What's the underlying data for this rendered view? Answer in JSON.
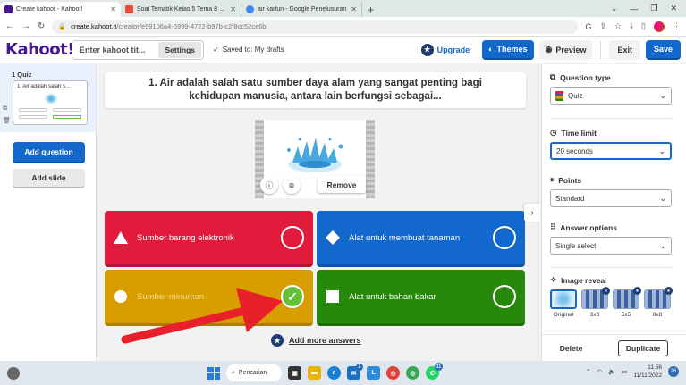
{
  "browser": {
    "tabs": [
      {
        "label": "Create kahoot - Kahoot!",
        "active": true,
        "favicon_color": "#46178f"
      },
      {
        "label": "Soal Tematik Kelas 5 Tema 8 Sub",
        "active": false,
        "favicon_color": "#e64b3c"
      },
      {
        "label": "air karfun - Google Penelusuran",
        "active": false,
        "favicon_color": "#4285f4"
      }
    ],
    "new_tab_label": "+",
    "url_host": "create.kahoot.it",
    "url_path": "/creator/e99106a4-6999-4722-b97b-c2f8cc52ce6b"
  },
  "header": {
    "logo": "Kahoot!",
    "title_placeholder": "Enter kahoot tit...",
    "settings_label": "Settings",
    "saved_text": "Saved to: My drafts",
    "upgrade_label": "Upgrade",
    "themes_label": "Themes",
    "preview_label": "Preview",
    "exit_label": "Exit",
    "save_label": "Save"
  },
  "sidebar": {
    "quiz_header": "1  Quiz",
    "quiz_thumb_title": "1. Air adalah salah s...",
    "add_question_label": "Add question",
    "add_slide_label": "Add slide"
  },
  "editor": {
    "question_text": "1. Air adalah salah satu sumber daya alam yang sangat penting bagi kehidupan manusia, antara lain berfungsi sebagai...",
    "remove_label": "Remove",
    "answers": [
      {
        "text": "Sumber barang elektronik",
        "color": "#e21b3c",
        "shape": "triangle",
        "correct": false
      },
      {
        "text": "Alat untuk membuat tanaman",
        "color": "#1368ce",
        "shape": "diamond",
        "correct": false
      },
      {
        "text": "Sumber minuman",
        "color": "#d89e00",
        "shape": "circle",
        "correct": true
      },
      {
        "text": "Alat untuk bahan bakar",
        "color": "#26890c",
        "shape": "square",
        "correct": false
      }
    ],
    "add_more_label": "Add more answers"
  },
  "panel": {
    "question_type_label": "Question type",
    "question_type_value": "Quiz",
    "time_limit_label": "Time limit",
    "time_limit_value": "20 seconds",
    "points_label": "Points",
    "points_value": "Standard",
    "answer_options_label": "Answer options",
    "answer_options_value": "Single select",
    "image_reveal_label": "Image reveal",
    "reveal_options": [
      "Original",
      "3x3",
      "5x5",
      "8x8"
    ],
    "delete_label": "Delete",
    "duplicate_label": "Duplicate"
  },
  "taskbar": {
    "search_label": "Pencarian",
    "time": "11.56",
    "date": "11/11/2022",
    "notification_count": "26",
    "badge_mail": "2",
    "badge_chat": "11"
  },
  "colors": {
    "kahoot_purple": "#46178f",
    "primary_blue": "#1368ce",
    "arrow_red": "#e8202a"
  }
}
